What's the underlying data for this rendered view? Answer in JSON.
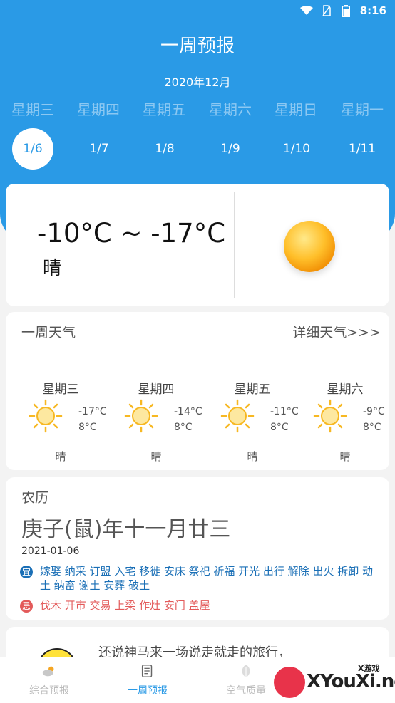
{
  "status_bar": {
    "time": "8:16"
  },
  "header": {
    "title": "一周预报",
    "month": "2020年12月",
    "weekdays": [
      "星期三",
      "星期四",
      "星期五",
      "星期六",
      "星期日",
      "星期一"
    ],
    "dates": [
      "1/6",
      "1/7",
      "1/8",
      "1/9",
      "1/10",
      "1/11"
    ],
    "selected_index": 0
  },
  "today": {
    "temp_range": "-10°C ~ -17°C",
    "condition": "晴",
    "icon": "sun-icon"
  },
  "week": {
    "title": "一周天气",
    "more_link": "详细天气>>>",
    "days": [
      {
        "name": "星期三",
        "high": "-17°C",
        "low": "8°C",
        "condition": "晴"
      },
      {
        "name": "星期四",
        "high": "-14°C",
        "low": "8°C",
        "condition": "晴"
      },
      {
        "name": "星期五",
        "high": "-11°C",
        "low": "8°C",
        "condition": "晴"
      },
      {
        "name": "星期六",
        "high": "-9°C",
        "low": "8°C",
        "condition": "晴"
      }
    ]
  },
  "lunar": {
    "label": "农历",
    "date": "庚子(鼠)年十一月廿三",
    "solar_date": "2021-01-06",
    "yi_badge": "宜",
    "yi": "嫁娶 纳采 订盟 入宅 移徙 安床 祭祀 祈福 开光 出行 解除 出火 拆卸 动土 纳畜 谢土 安葬 破土",
    "ji_badge": "忌",
    "ji": "伐木 开市 交易 上梁 作灶 安门 盖屋"
  },
  "story": {
    "text": "还说神马来一场说走就走的旅行，"
  },
  "tabs": [
    {
      "label": "综合预报",
      "icon": "cloud-sun-icon"
    },
    {
      "label": "一周预报",
      "icon": "calendar-icon"
    },
    {
      "label": "空气质量",
      "icon": "leaf-icon"
    }
  ],
  "active_tab": 1,
  "watermark": {
    "text": "XYouXi.net",
    "small": "X游戏"
  },
  "colors": {
    "primary": "#2a9ae6",
    "yi": "#1a6fb6",
    "ji": "#e35a5a"
  }
}
